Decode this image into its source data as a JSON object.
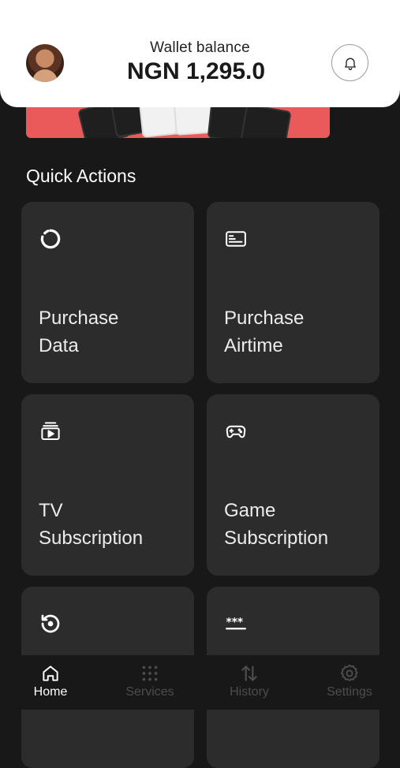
{
  "header": {
    "wallet_label": "Wallet balance",
    "wallet_amount": "NGN 1,295.0",
    "avatar_icon": "user-avatar",
    "bell_icon": "bell-icon"
  },
  "section": {
    "title": "Quick Actions"
  },
  "actions": [
    {
      "line1": "Purchase",
      "line2": "Data",
      "icon": "loading-circle-icon"
    },
    {
      "line1": "Purchase",
      "line2": "Airtime",
      "icon": "sim-card-icon"
    },
    {
      "line1": "TV",
      "line2": "Subscription",
      "icon": "tv-play-icon"
    },
    {
      "line1": "Game",
      "line2": "Subscription",
      "icon": "gamepad-icon"
    },
    {
      "icon": "history-icon"
    },
    {
      "icon": "password-icon"
    }
  ],
  "nav": [
    {
      "label": "Home",
      "icon": "home-icon",
      "active": true
    },
    {
      "label": "Services",
      "icon": "grid-icon",
      "active": false
    },
    {
      "label": "History",
      "icon": "arrows-up-down-icon",
      "active": false
    },
    {
      "label": "Settings",
      "icon": "gear-icon",
      "active": false
    }
  ],
  "colors": {
    "background": "#181818",
    "card": "#2c2c2c",
    "banner": "#ea5a5a",
    "nav_inactive": "#4d4d4d"
  }
}
